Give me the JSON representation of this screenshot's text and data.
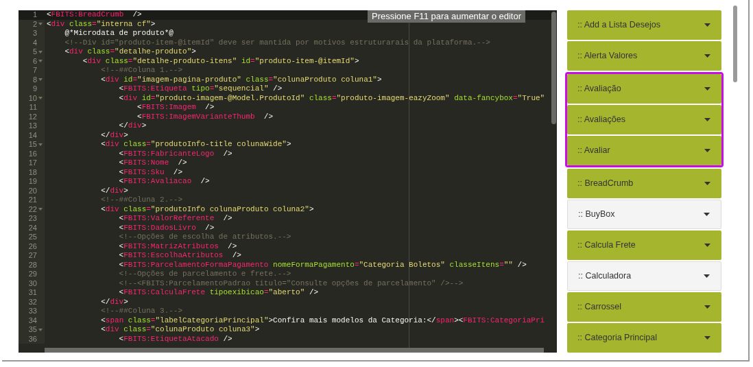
{
  "editor": {
    "tooltip": "Pressione F11 para aumentar o editor",
    "lines": [
      {
        "number": "1",
        "active": true,
        "fold": false,
        "tokens": [
          {
            "kind": "punct",
            "text": "<"
          },
          {
            "kind": "tag",
            "text": "FBITS:BreadCrumb"
          },
          {
            "kind": "punct",
            "text": "  />"
          }
        ]
      },
      {
        "number": "2",
        "active": false,
        "fold": true,
        "tokens": [
          {
            "kind": "punct",
            "text": "<"
          },
          {
            "kind": "tag",
            "text": "div"
          },
          {
            "kind": "attr",
            "text": " class"
          },
          {
            "kind": "eq",
            "text": "="
          },
          {
            "kind": "str",
            "text": "\"interna cf\""
          },
          {
            "kind": "punct",
            "text": ">"
          }
        ]
      },
      {
        "number": "3",
        "active": false,
        "fold": false,
        "tokens": [
          {
            "kind": "text",
            "text": "    @*Microdata de produto*@"
          }
        ]
      },
      {
        "number": "4",
        "active": false,
        "fold": false,
        "tokens": [
          {
            "kind": "comment",
            "text": "    <!--Div id=\"produto-item-@itemId\" deve ser mantida por motivos estruturarais da plataforma.-->"
          }
        ]
      },
      {
        "number": "5",
        "active": false,
        "fold": true,
        "tokens": [
          {
            "kind": "punct",
            "text": "    <"
          },
          {
            "kind": "tag",
            "text": "div"
          },
          {
            "kind": "attr",
            "text": " class"
          },
          {
            "kind": "eq",
            "text": "="
          },
          {
            "kind": "str",
            "text": "\"detalhe-produto\""
          },
          {
            "kind": "punct",
            "text": ">"
          }
        ]
      },
      {
        "number": "6",
        "active": false,
        "fold": true,
        "tokens": [
          {
            "kind": "punct",
            "text": "        <"
          },
          {
            "kind": "tag",
            "text": "div"
          },
          {
            "kind": "attr",
            "text": " class"
          },
          {
            "kind": "eq",
            "text": "="
          },
          {
            "kind": "str",
            "text": "\"detalhe-produto-itens\""
          },
          {
            "kind": "attr",
            "text": " id"
          },
          {
            "kind": "eq",
            "text": "="
          },
          {
            "kind": "str",
            "text": "\"produto-item-@itemId\""
          },
          {
            "kind": "punct",
            "text": ">"
          }
        ]
      },
      {
        "number": "7",
        "active": false,
        "fold": false,
        "tokens": [
          {
            "kind": "comment",
            "text": "            <!--##Coluna 1.-->"
          }
        ]
      },
      {
        "number": "8",
        "active": false,
        "fold": true,
        "tokens": [
          {
            "kind": "punct",
            "text": "            <"
          },
          {
            "kind": "tag",
            "text": "div"
          },
          {
            "kind": "attr",
            "text": " id"
          },
          {
            "kind": "eq",
            "text": "="
          },
          {
            "kind": "str",
            "text": "\"imagem-pagina-produto\""
          },
          {
            "kind": "attr",
            "text": " class"
          },
          {
            "kind": "eq",
            "text": "="
          },
          {
            "kind": "str",
            "text": "\"colunaProduto coluna1\""
          },
          {
            "kind": "punct",
            "text": ">"
          }
        ]
      },
      {
        "number": "9",
        "active": false,
        "fold": false,
        "tokens": [
          {
            "kind": "punct",
            "text": "                <"
          },
          {
            "kind": "tag",
            "text": "FBITS:Etiqueta"
          },
          {
            "kind": "attr",
            "text": " tipo"
          },
          {
            "kind": "eq",
            "text": "="
          },
          {
            "kind": "str",
            "text": "\"sequencial\""
          },
          {
            "kind": "punct",
            "text": " />"
          }
        ]
      },
      {
        "number": "10",
        "active": false,
        "fold": true,
        "tokens": [
          {
            "kind": "punct",
            "text": "                <"
          },
          {
            "kind": "tag",
            "text": "div"
          },
          {
            "kind": "attr",
            "text": " id"
          },
          {
            "kind": "eq",
            "text": "="
          },
          {
            "kind": "str",
            "text": "\"produto-imagem-@Model.ProdutoId\""
          },
          {
            "kind": "attr",
            "text": " class"
          },
          {
            "kind": "eq",
            "text": "="
          },
          {
            "kind": "str",
            "text": "\"produto-imagem-eazyZoom\""
          },
          {
            "kind": "attr",
            "text": " data-fancybox"
          },
          {
            "kind": "eq",
            "text": "="
          },
          {
            "kind": "str",
            "text": "\"True\""
          }
        ]
      },
      {
        "number": "11",
        "active": false,
        "fold": false,
        "tokens": [
          {
            "kind": "punct",
            "text": "                    <"
          },
          {
            "kind": "tag",
            "text": "FBITS:Imagem"
          },
          {
            "kind": "punct",
            "text": "  />"
          }
        ]
      },
      {
        "number": "12",
        "active": false,
        "fold": false,
        "tokens": [
          {
            "kind": "punct",
            "text": "                    <"
          },
          {
            "kind": "tag",
            "text": "FBITS:ImagemVarianteThumb"
          },
          {
            "kind": "punct",
            "text": "  />"
          }
        ]
      },
      {
        "number": "13",
        "active": false,
        "fold": false,
        "tokens": [
          {
            "kind": "punct",
            "text": "                </"
          },
          {
            "kind": "tag",
            "text": "div"
          },
          {
            "kind": "punct",
            "text": ">"
          }
        ]
      },
      {
        "number": "14",
        "active": false,
        "fold": false,
        "tokens": [
          {
            "kind": "punct",
            "text": "            </"
          },
          {
            "kind": "tag",
            "text": "div"
          },
          {
            "kind": "punct",
            "text": ">"
          }
        ]
      },
      {
        "number": "15",
        "active": false,
        "fold": true,
        "tokens": [
          {
            "kind": "punct",
            "text": "            <"
          },
          {
            "kind": "tag",
            "text": "div"
          },
          {
            "kind": "attr",
            "text": " class"
          },
          {
            "kind": "eq",
            "text": "="
          },
          {
            "kind": "str",
            "text": "\"produtoInfo-title colunaWide\""
          },
          {
            "kind": "punct",
            "text": ">"
          }
        ]
      },
      {
        "number": "16",
        "active": false,
        "fold": false,
        "tokens": [
          {
            "kind": "punct",
            "text": "                <"
          },
          {
            "kind": "tag",
            "text": "FBITS:FabricanteLogo"
          },
          {
            "kind": "punct",
            "text": "  />"
          }
        ]
      },
      {
        "number": "17",
        "active": false,
        "fold": false,
        "tokens": [
          {
            "kind": "punct",
            "text": "                <"
          },
          {
            "kind": "tag",
            "text": "FBITS:Nome"
          },
          {
            "kind": "punct",
            "text": "  />"
          }
        ]
      },
      {
        "number": "18",
        "active": false,
        "fold": false,
        "tokens": [
          {
            "kind": "punct",
            "text": "                <"
          },
          {
            "kind": "tag",
            "text": "FBITS:Sku"
          },
          {
            "kind": "punct",
            "text": "  />"
          }
        ]
      },
      {
        "number": "19",
        "active": false,
        "fold": false,
        "tokens": [
          {
            "kind": "punct",
            "text": "                <"
          },
          {
            "kind": "tag",
            "text": "FBITS:Avaliacao"
          },
          {
            "kind": "punct",
            "text": "  />"
          }
        ]
      },
      {
        "number": "20",
        "active": false,
        "fold": false,
        "tokens": [
          {
            "kind": "punct",
            "text": "            </"
          },
          {
            "kind": "tag",
            "text": "div"
          },
          {
            "kind": "punct",
            "text": ">"
          }
        ]
      },
      {
        "number": "21",
        "active": false,
        "fold": false,
        "tokens": [
          {
            "kind": "comment",
            "text": "            <!--##Coluna 2.-->"
          }
        ]
      },
      {
        "number": "22",
        "active": false,
        "fold": true,
        "tokens": [
          {
            "kind": "punct",
            "text": "            <"
          },
          {
            "kind": "tag",
            "text": "div"
          },
          {
            "kind": "attr",
            "text": " class"
          },
          {
            "kind": "eq",
            "text": "="
          },
          {
            "kind": "str",
            "text": "\"produtoInfo colunaProduto coluna2\""
          },
          {
            "kind": "punct",
            "text": ">"
          }
        ]
      },
      {
        "number": "23",
        "active": false,
        "fold": false,
        "tokens": [
          {
            "kind": "punct",
            "text": "                <"
          },
          {
            "kind": "tag",
            "text": "FBITS:ValorReferente"
          },
          {
            "kind": "punct",
            "text": "  />"
          }
        ]
      },
      {
        "number": "24",
        "active": false,
        "fold": false,
        "tokens": [
          {
            "kind": "punct",
            "text": "                <"
          },
          {
            "kind": "tag",
            "text": "FBITS:DadosLivro"
          },
          {
            "kind": "punct",
            "text": "  />"
          }
        ]
      },
      {
        "number": "25",
        "active": false,
        "fold": false,
        "tokens": [
          {
            "kind": "comment",
            "text": "                <!--Opções de escolha de atributos.-->"
          }
        ]
      },
      {
        "number": "26",
        "active": false,
        "fold": false,
        "tokens": [
          {
            "kind": "punct",
            "text": "                <"
          },
          {
            "kind": "tag",
            "text": "FBITS:MatrizAtributos"
          },
          {
            "kind": "punct",
            "text": "  />"
          }
        ]
      },
      {
        "number": "27",
        "active": false,
        "fold": false,
        "tokens": [
          {
            "kind": "punct",
            "text": "                <"
          },
          {
            "kind": "tag",
            "text": "FBITS:EscolhaAtributos"
          },
          {
            "kind": "punct",
            "text": "  />"
          }
        ]
      },
      {
        "number": "28",
        "active": false,
        "fold": false,
        "tokens": [
          {
            "kind": "punct",
            "text": "                <"
          },
          {
            "kind": "tag",
            "text": "FBITS:ParcelamentoFormaPagamento"
          },
          {
            "kind": "attr",
            "text": " nomeFormaPagamento"
          },
          {
            "kind": "eq",
            "text": "="
          },
          {
            "kind": "str",
            "text": "\"Categoria Boletos\""
          },
          {
            "kind": "attr",
            "text": " classeItens"
          },
          {
            "kind": "eq",
            "text": "="
          },
          {
            "kind": "str",
            "text": "\"\""
          },
          {
            "kind": "punct",
            "text": " />"
          }
        ]
      },
      {
        "number": "29",
        "active": false,
        "fold": false,
        "tokens": [
          {
            "kind": "comment",
            "text": "                <!--Opções de parcelamento e frete.-->"
          }
        ]
      },
      {
        "number": "30",
        "active": false,
        "fold": false,
        "tokens": [
          {
            "kind": "comment",
            "text": "                <!--<FBITS:ParcelamentoPadrao titulo=\"Consulte opções de parcelamento\" />-->"
          }
        ]
      },
      {
        "number": "31",
        "active": false,
        "fold": false,
        "tokens": [
          {
            "kind": "punct",
            "text": "                <"
          },
          {
            "kind": "tag",
            "text": "FBITS:CalculaFrete"
          },
          {
            "kind": "attr",
            "text": " tipoexibicao"
          },
          {
            "kind": "eq",
            "text": "="
          },
          {
            "kind": "str",
            "text": "\"aberto\""
          },
          {
            "kind": "punct",
            "text": " />"
          }
        ]
      },
      {
        "number": "32",
        "active": false,
        "fold": false,
        "tokens": [
          {
            "kind": "punct",
            "text": "            </"
          },
          {
            "kind": "tag",
            "text": "div"
          },
          {
            "kind": "punct",
            "text": ">"
          }
        ]
      },
      {
        "number": "33",
        "active": false,
        "fold": false,
        "tokens": [
          {
            "kind": "comment",
            "text": "            <!--##Coluna 3.-->"
          }
        ]
      },
      {
        "number": "34",
        "active": false,
        "fold": false,
        "tokens": [
          {
            "kind": "punct",
            "text": "            <"
          },
          {
            "kind": "tag",
            "text": "span"
          },
          {
            "kind": "attr",
            "text": " class"
          },
          {
            "kind": "eq",
            "text": "="
          },
          {
            "kind": "str",
            "text": "\"labelCategoriaPrincipal\""
          },
          {
            "kind": "text",
            "text": ">Confira mais modelos da Categoria:</"
          },
          {
            "kind": "tag",
            "text": "span"
          },
          {
            "kind": "punct",
            "text": "><"
          },
          {
            "kind": "tag",
            "text": "FBITS:CategoriaPri"
          }
        ]
      },
      {
        "number": "35",
        "active": false,
        "fold": true,
        "tokens": [
          {
            "kind": "punct",
            "text": "            <"
          },
          {
            "kind": "tag",
            "text": "div"
          },
          {
            "kind": "attr",
            "text": " class"
          },
          {
            "kind": "eq",
            "text": "="
          },
          {
            "kind": "str",
            "text": "\"colunaProduto coluna3\""
          },
          {
            "kind": "punct",
            "text": ">"
          }
        ]
      },
      {
        "number": "36",
        "active": false,
        "fold": false,
        "tokens": [
          {
            "kind": "punct",
            "text": "                <"
          },
          {
            "kind": "tag",
            "text": "FBITS:EtiquetaAtacado"
          },
          {
            "kind": "punct",
            "text": " />"
          }
        ]
      }
    ]
  },
  "components": [
    {
      "label": ":: Add a Lista Desejos",
      "active": true,
      "highlighted": false
    },
    {
      "label": ":: Alerta Valores",
      "active": true,
      "highlighted": false
    },
    {
      "label": ":: Avaliação",
      "active": true,
      "highlighted": true
    },
    {
      "label": ":: Avaliações",
      "active": true,
      "highlighted": true
    },
    {
      "label": ":: Avaliar",
      "active": true,
      "highlighted": true
    },
    {
      "label": ":: BreadCrumb",
      "active": true,
      "highlighted": false
    },
    {
      "label": ":: BuyBox",
      "active": false,
      "highlighted": false
    },
    {
      "label": ":: Calcula Frete",
      "active": true,
      "highlighted": false
    },
    {
      "label": ":: Calculadora",
      "active": false,
      "highlighted": false
    },
    {
      "label": ":: Carrossel",
      "active": true,
      "highlighted": false
    },
    {
      "label": ":: Categoria Principal",
      "active": true,
      "highlighted": false
    }
  ]
}
